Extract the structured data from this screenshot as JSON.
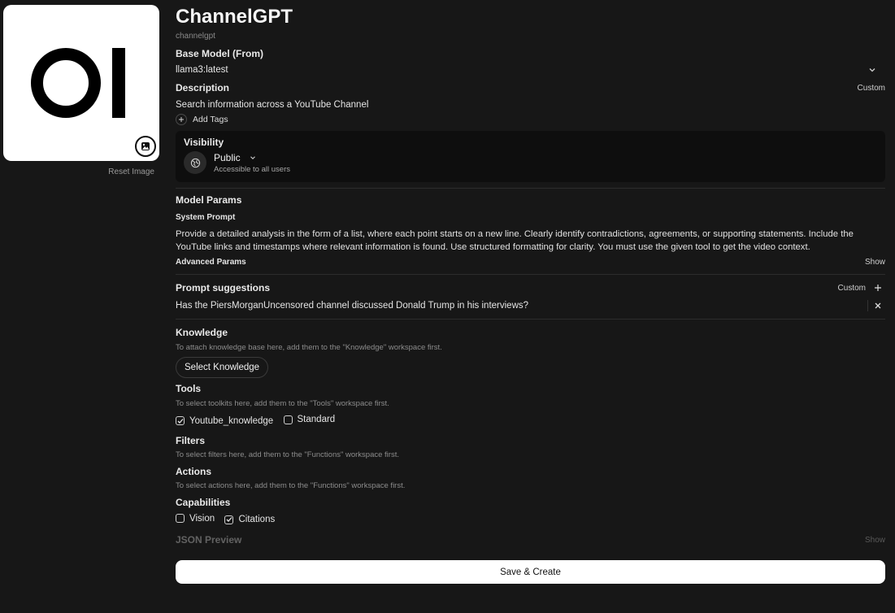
{
  "model": {
    "name": "ChannelGPT",
    "id": "channelgpt",
    "reset_image_label": "Reset Image"
  },
  "base_model": {
    "label": "Base Model (From)",
    "value": "llama3:latest"
  },
  "description": {
    "label": "Description",
    "mode": "Custom",
    "value": "Search information across a YouTube Channel"
  },
  "tags": {
    "add_label": "Add Tags"
  },
  "visibility": {
    "label": "Visibility",
    "value": "Public",
    "hint": "Accessible to all users"
  },
  "model_params": {
    "label": "Model Params",
    "system_prompt_label": "System Prompt",
    "system_prompt": "Provide a detailed analysis in the form of a list, where each point starts on a new line. Clearly identify contradictions, agreements, or supporting statements. Include the YouTube links and timestamps where relevant information is found. Use structured formatting for clarity. You must use the given tool to get the video context.",
    "advanced_label": "Advanced Params",
    "advanced_toggle": "Show"
  },
  "prompt_suggestions": {
    "label": "Prompt suggestions",
    "mode": "Custom",
    "items": [
      "Has the PiersMorganUncensored channel discussed Donald Trump in his interviews?"
    ]
  },
  "knowledge": {
    "label": "Knowledge",
    "hint": "To attach knowledge base here, add them to the \"Knowledge\" workspace first.",
    "button": "Select Knowledge"
  },
  "tools": {
    "label": "Tools",
    "hint": "To select toolkits here, add them to the \"Tools\" workspace first.",
    "items": [
      {
        "label": "Youtube_knowledge",
        "checked": true
      },
      {
        "label": "Standard",
        "checked": false
      }
    ]
  },
  "filters": {
    "label": "Filters",
    "hint": "To select filters here, add them to the \"Functions\" workspace first."
  },
  "actions": {
    "label": "Actions",
    "hint": "To select actions here, add them to the \"Functions\" workspace first."
  },
  "capabilities": {
    "label": "Capabilities",
    "items": [
      {
        "label": "Vision",
        "checked": false
      },
      {
        "label": "Citations",
        "checked": true
      }
    ]
  },
  "json_preview": {
    "label": "JSON Preview",
    "toggle": "Show"
  },
  "save_button": "Save & Create",
  "icons": {
    "image": "image-icon",
    "chevron": "chevron-down-icon",
    "plus": "plus-icon",
    "globe": "globe-icon",
    "close": "close-icon",
    "check": "check-icon"
  }
}
